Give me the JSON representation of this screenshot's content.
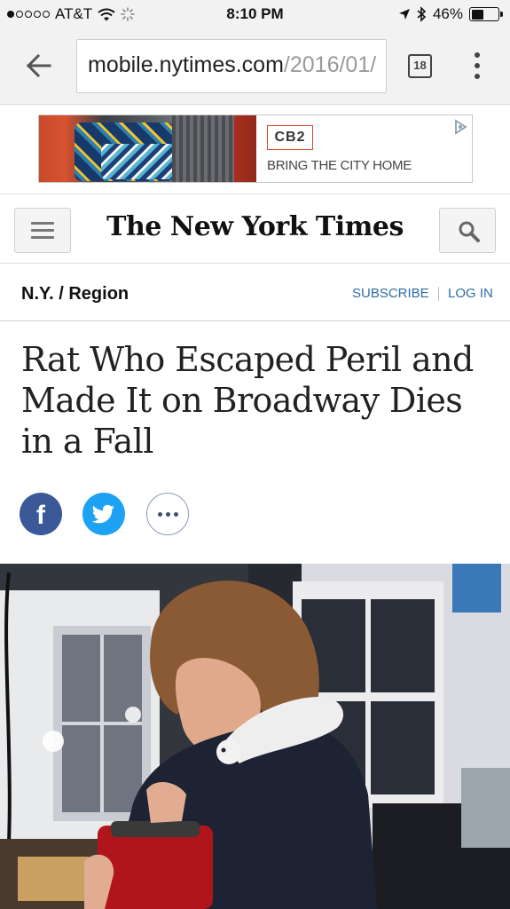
{
  "status_bar": {
    "carrier": "AT&T",
    "time": "8:10 PM",
    "battery_percent": "46%",
    "battery_level": 0.46,
    "signal_bars_filled": 1,
    "signal_bars_total": 5
  },
  "browser": {
    "url_host": "mobile.nytimes.com",
    "url_path": "/2016/01/",
    "tab_count": "18",
    "icons": [
      "back-arrow-icon",
      "tabs-icon",
      "overflow-menu-icon"
    ]
  },
  "ad": {
    "brand": "CB2",
    "tagline": "BRING THE CITY HOME",
    "brand_color": "#d9452c"
  },
  "header": {
    "logo": "The New York Times",
    "icons": [
      "hamburger-menu-icon",
      "search-icon"
    ]
  },
  "section": {
    "name": "N.Y. / Region",
    "subscribe": "SUBSCRIBE",
    "login": "LOG IN",
    "link_color": "#2e6ea6"
  },
  "article": {
    "headline": "Rat Who Escaped Peril and Made It on Broadway Dies in a Fall"
  },
  "share": {
    "icons": [
      "facebook-icon",
      "twitter-icon",
      "more-icon"
    ],
    "facebook_color": "#3b5998",
    "twitter_color": "#1da1f2"
  }
}
